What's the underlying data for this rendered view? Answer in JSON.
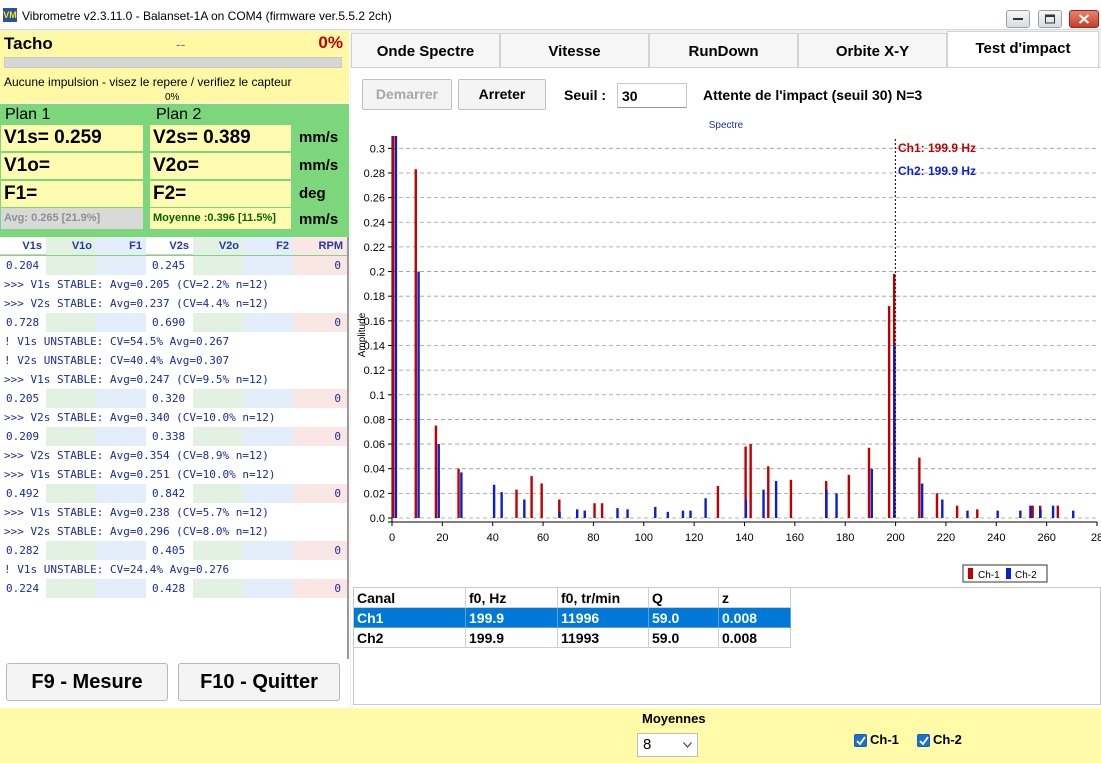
{
  "window": {
    "title": "Vibrometre v2.3.11.0 - Balanset-1A on COM4 (firmware ver.5.5.2 2ch)",
    "icon_text": "VM"
  },
  "tacho": {
    "title": "Tacho",
    "value": "--",
    "percent": "0%",
    "progress": 0,
    "message": "Aucune impulsion - visez le repere / verifiez le capteur",
    "sub_percent": "0%"
  },
  "plan1": {
    "title": "Plan 1",
    "v1s": "V1s= 0.259",
    "v1o": "V1o=",
    "f1": "F1=",
    "avg": "Avg: 0.265 [21.9%]"
  },
  "plan2": {
    "title": "Plan 2",
    "v2s": "V2s= 0.389",
    "v2o": "V2o=",
    "f2": "F2=",
    "avg": "Moyenne :0.396 [11.5%]"
  },
  "units": [
    "mm/s",
    "mm/s",
    "deg",
    "mm/s"
  ],
  "table_headers": [
    "V1s",
    "V1o",
    "F1",
    "V2s",
    "V2o",
    "F2",
    "RPM"
  ],
  "log": [
    {
      "type": "row",
      "v1s": "0.204",
      "v2s": "0.245",
      "rpm": "0"
    },
    {
      "type": "msg",
      "text": ">>> V1s STABLE: Avg=0.205 (CV=2.2% n=12)"
    },
    {
      "type": "msg",
      "text": ">>> V2s STABLE: Avg=0.237 (CV=4.4% n=12)"
    },
    {
      "type": "row",
      "v1s": "0.728",
      "v2s": "0.690",
      "rpm": "0"
    },
    {
      "type": "msg",
      "text": "! V1s UNSTABLE: CV=54.5% Avg=0.267"
    },
    {
      "type": "msg",
      "text": "! V2s UNSTABLE: CV=40.4% Avg=0.307"
    },
    {
      "type": "msg",
      "text": ">>> V1s STABLE: Avg=0.247 (CV=9.5% n=12)"
    },
    {
      "type": "row",
      "v1s": "0.205",
      "v2s": "0.320",
      "rpm": "0"
    },
    {
      "type": "msg",
      "text": ">>> V2s STABLE: Avg=0.340 (CV=10.0% n=12)"
    },
    {
      "type": "row",
      "v1s": "0.209",
      "v2s": "0.338",
      "rpm": "0"
    },
    {
      "type": "msg",
      "text": ">>> V2s STABLE: Avg=0.354 (CV=8.9% n=12)"
    },
    {
      "type": "msg",
      "text": ">>> V1s STABLE: Avg=0.251 (CV=10.0% n=12)"
    },
    {
      "type": "row",
      "v1s": "0.492",
      "v2s": "0.842",
      "rpm": "0"
    },
    {
      "type": "msg",
      "text": ">>> V1s STABLE: Avg=0.238 (CV=5.7% n=12)"
    },
    {
      "type": "msg",
      "text": ">>> V2s STABLE: Avg=0.296 (CV=8.0% n=12)"
    },
    {
      "type": "row",
      "v1s": "0.282",
      "v2s": "0.405",
      "rpm": "0"
    },
    {
      "type": "msg",
      "text": "! V1s UNSTABLE: CV=24.4% Avg=0.276"
    },
    {
      "type": "row",
      "v1s": "0.224",
      "v2s": "0.428",
      "rpm": "0"
    }
  ],
  "buttons": {
    "f9": "F9 - Mesure",
    "f10": "F10 - Quitter",
    "start": "Demarrer",
    "stop": "Arreter"
  },
  "tabs": [
    {
      "label": "Onde Spectre",
      "active": false
    },
    {
      "label": "Vitesse",
      "active": false
    },
    {
      "label": "RunDown",
      "active": false
    },
    {
      "label": "Orbite X-Y",
      "active": false
    },
    {
      "label": "Test d'impact",
      "active": true
    }
  ],
  "impact": {
    "threshold_label": "Seuil :",
    "threshold_value": "30",
    "status": "Attente de l'impact (seuil 30)  N=3"
  },
  "chart_data": {
    "type": "bar",
    "title": "Spectre",
    "ylabel": "Amplitude",
    "xlabel": "",
    "xlim": [
      0,
      280
    ],
    "ylim": [
      0,
      0.31
    ],
    "xticks": [
      0,
      20,
      40,
      60,
      80,
      100,
      120,
      140,
      160,
      180,
      200,
      220,
      240,
      260,
      280
    ],
    "xtick_labels": [
      "0",
      "20",
      "40",
      "60",
      "80",
      "100",
      "120",
      "140",
      "160",
      "180",
      "200",
      "220",
      "240",
      "260",
      "28"
    ],
    "yticks": [
      0.0,
      0.02,
      0.04,
      0.06,
      0.08,
      0.1,
      0.12,
      0.14,
      0.16,
      0.18,
      0.2,
      0.22,
      0.24,
      0.26,
      0.28,
      0.3
    ],
    "ytick_labels": [
      "0.0",
      "0.02",
      "0.04",
      "0.06",
      "0.08",
      "0.1",
      "0.12",
      "0.14",
      "0.16",
      "0.18",
      "0.2",
      "0.22",
      "0.24",
      "0.26",
      "0.28",
      "0.3"
    ],
    "marker_x": 199.9,
    "annotations": [
      "Ch1: 199.9 Hz",
      "Ch2: 199.9 Hz"
    ],
    "legend_position": "bottom-right",
    "grid": true,
    "series": [
      {
        "name": "Ch-1",
        "color": "#c00000",
        "points": [
          [
            1,
            0.31
          ],
          [
            10,
            0.283
          ],
          [
            18,
            0.075
          ],
          [
            27,
            0.04
          ],
          [
            50,
            0.023
          ],
          [
            56,
            0.034
          ],
          [
            60,
            0.028
          ],
          [
            67,
            0.015
          ],
          [
            81,
            0.012
          ],
          [
            84,
            0.012
          ],
          [
            130,
            0.026
          ],
          [
            141,
            0.058
          ],
          [
            143,
            0.06
          ],
          [
            150,
            0.042
          ],
          [
            159,
            0.031
          ],
          [
            173,
            0.03
          ],
          [
            182,
            0.035
          ],
          [
            190,
            0.057
          ],
          [
            198,
            0.172
          ],
          [
            200,
            0.198
          ],
          [
            210,
            0.049
          ],
          [
            217,
            0.02
          ],
          [
            225,
            0.01
          ],
          [
            233,
            0.007
          ],
          [
            255,
            0.01
          ],
          [
            258,
            0.01
          ],
          [
            265,
            0.01
          ]
        ]
      },
      {
        "name": "Ch-2",
        "color": "#0a1fd0",
        "points": [
          [
            1,
            0.31
          ],
          [
            10,
            0.2
          ],
          [
            18,
            0.06
          ],
          [
            27,
            0.037
          ],
          [
            40,
            0.027
          ],
          [
            43,
            0.021
          ],
          [
            52,
            0.015
          ],
          [
            66,
            0.005
          ],
          [
            73,
            0.007
          ],
          [
            76,
            0.006
          ],
          [
            89,
            0.008
          ],
          [
            93,
            0.007
          ],
          [
            104,
            0.009
          ],
          [
            109,
            0.005
          ],
          [
            115,
            0.006
          ],
          [
            118,
            0.006
          ],
          [
            124,
            0.016
          ],
          [
            140,
            0.015
          ],
          [
            147,
            0.023
          ],
          [
            152,
            0.03
          ],
          [
            172,
            0.023
          ],
          [
            176,
            0.02
          ],
          [
            190,
            0.04
          ],
          [
            199,
            0.14
          ],
          [
            210,
            0.028
          ],
          [
            218,
            0.015
          ],
          [
            228,
            0.006
          ],
          [
            240,
            0.006
          ],
          [
            249,
            0.006
          ],
          [
            253,
            0.01
          ],
          [
            257,
            0.007
          ],
          [
            262,
            0.01
          ],
          [
            270,
            0.006
          ]
        ]
      }
    ]
  },
  "results": {
    "headers": [
      "Canal",
      "f0, Hz",
      "f0, tr/min",
      "Q",
      "z"
    ],
    "rows": [
      [
        "Ch1",
        "199.9",
        "11996",
        "59.0",
        "0.008"
      ],
      [
        "Ch2",
        "199.9",
        "11993",
        "59.0",
        "0.008"
      ]
    ]
  },
  "bottom": {
    "averages_label": "Moyennes",
    "averages_value": "8",
    "ch1_label": "Ch-1",
    "ch2_label": "Ch-2"
  }
}
